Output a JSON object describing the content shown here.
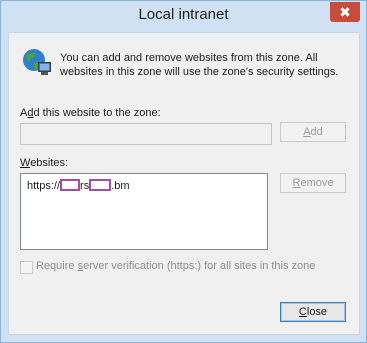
{
  "window": {
    "title": "Local intranet",
    "close_glyph": "✖"
  },
  "intro": {
    "text": "You can add and remove websites from this zone. All websites in this zone will use the zone's security settings.",
    "icon": "globe-monitor-icon"
  },
  "add": {
    "label_prefix": "A",
    "label_mnemonic": "d",
    "label_suffix": "d this website to the zone:",
    "value": "",
    "button_prefix": "",
    "button_mnemonic": "A",
    "button_suffix": "dd"
  },
  "websites": {
    "label_prefix": "",
    "label_mnemonic": "W",
    "label_suffix": "ebsites:",
    "items": [
      {
        "part1": "https://",
        "part2": "rs",
        "part3": ".bm"
      }
    ],
    "remove_prefix": "",
    "remove_mnemonic": "R",
    "remove_suffix": "emove"
  },
  "verify": {
    "checked": false,
    "label_prefix": "Require ",
    "label_mnemonic": "s",
    "label_suffix": "erver verification (https:) for all sites in this zone"
  },
  "footer": {
    "close_prefix": "",
    "close_mnemonic": "C",
    "close_suffix": "lose"
  }
}
